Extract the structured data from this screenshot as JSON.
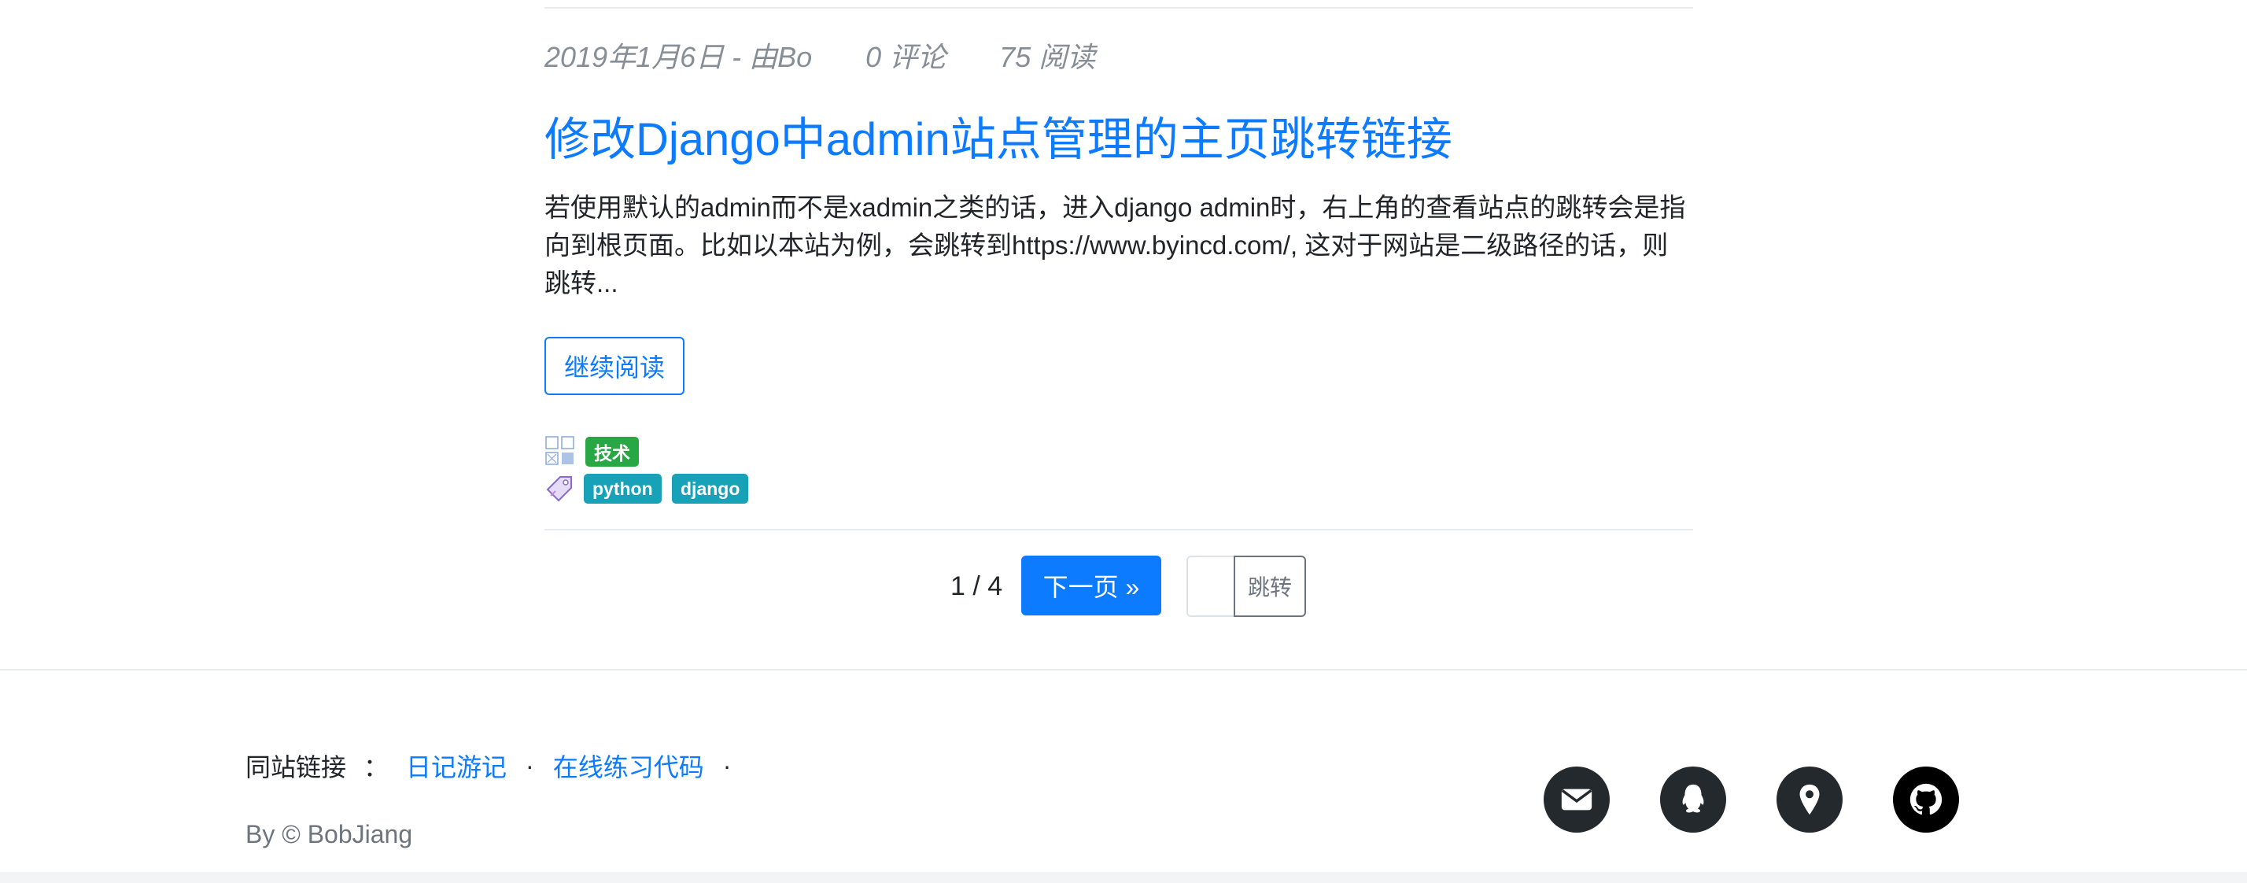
{
  "post": {
    "date": "2019年1月6日 - 由Bo",
    "comments": "0 评论",
    "views": "75 阅读",
    "title": "修改Django中admin站点管理的主页跳转链接",
    "excerpt": "若使用默认的admin而不是xadmin之类的话，进入django admin时，右上角的查看站点的跳转会是指向到根页面。比如以本站为例，会跳转到https://www.byincd.com/, 这对于网站是二级路径的话，则跳转...",
    "read_more": "继续阅读",
    "category": "技术",
    "tags": [
      "python",
      "django"
    ]
  },
  "pagination": {
    "count": "1 / 4",
    "next": "下一页 »",
    "jump": "跳转"
  },
  "footer": {
    "links_label": "同站链接",
    "colon": "：",
    "links": [
      "日记游记",
      "在线练习代码"
    ],
    "dot": "·",
    "copyright": "By © BobJiang"
  },
  "social_icons": [
    "email-icon",
    "qq-icon",
    "location-icon",
    "github-icon"
  ],
  "colors": {
    "link": "#0d7bff",
    "category_badge": "#28a745",
    "tag_badge": "#17a2b8",
    "social_bg": "#24292e"
  }
}
